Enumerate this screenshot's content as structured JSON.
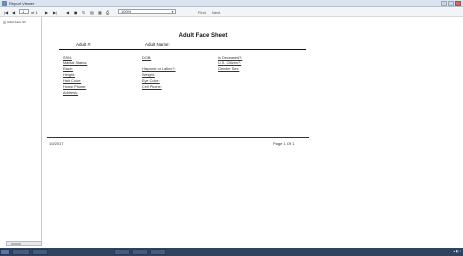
{
  "window": {
    "title": "Report Viewer"
  },
  "toolbar": {
    "nav_first": "|◀",
    "nav_prev": "◀",
    "page_input": "1",
    "page_of": "of 1",
    "nav_next": "▶",
    "nav_last": "▶|",
    "zoom": "100%",
    "find_label": "Find",
    "next_label": "Next"
  },
  "sidebar": {
    "item_label": "Adult Face Sh"
  },
  "report": {
    "title": "Adult Face Sheet",
    "col1": "Adult #:",
    "col2": "Adult Name:",
    "fields": [
      "SSN:",
      "Marital Status:",
      "Race:",
      "Height:",
      "Hair Color:",
      "Home Phone:",
      "Address:",
      "DOB:",
      "Weight:",
      "Eye Color:",
      "Cell Phone:",
      "Hispanic or Latino?:",
      "Is Deceased?:",
      "U.S. Citizen?:",
      "Gender Sex:"
    ],
    "footer_date": "10/2017",
    "footer_page": "Page 1 Of 1"
  },
  "colors": {
    "titlebar": "#dbe3ef",
    "taskbar": "#2f4260"
  }
}
